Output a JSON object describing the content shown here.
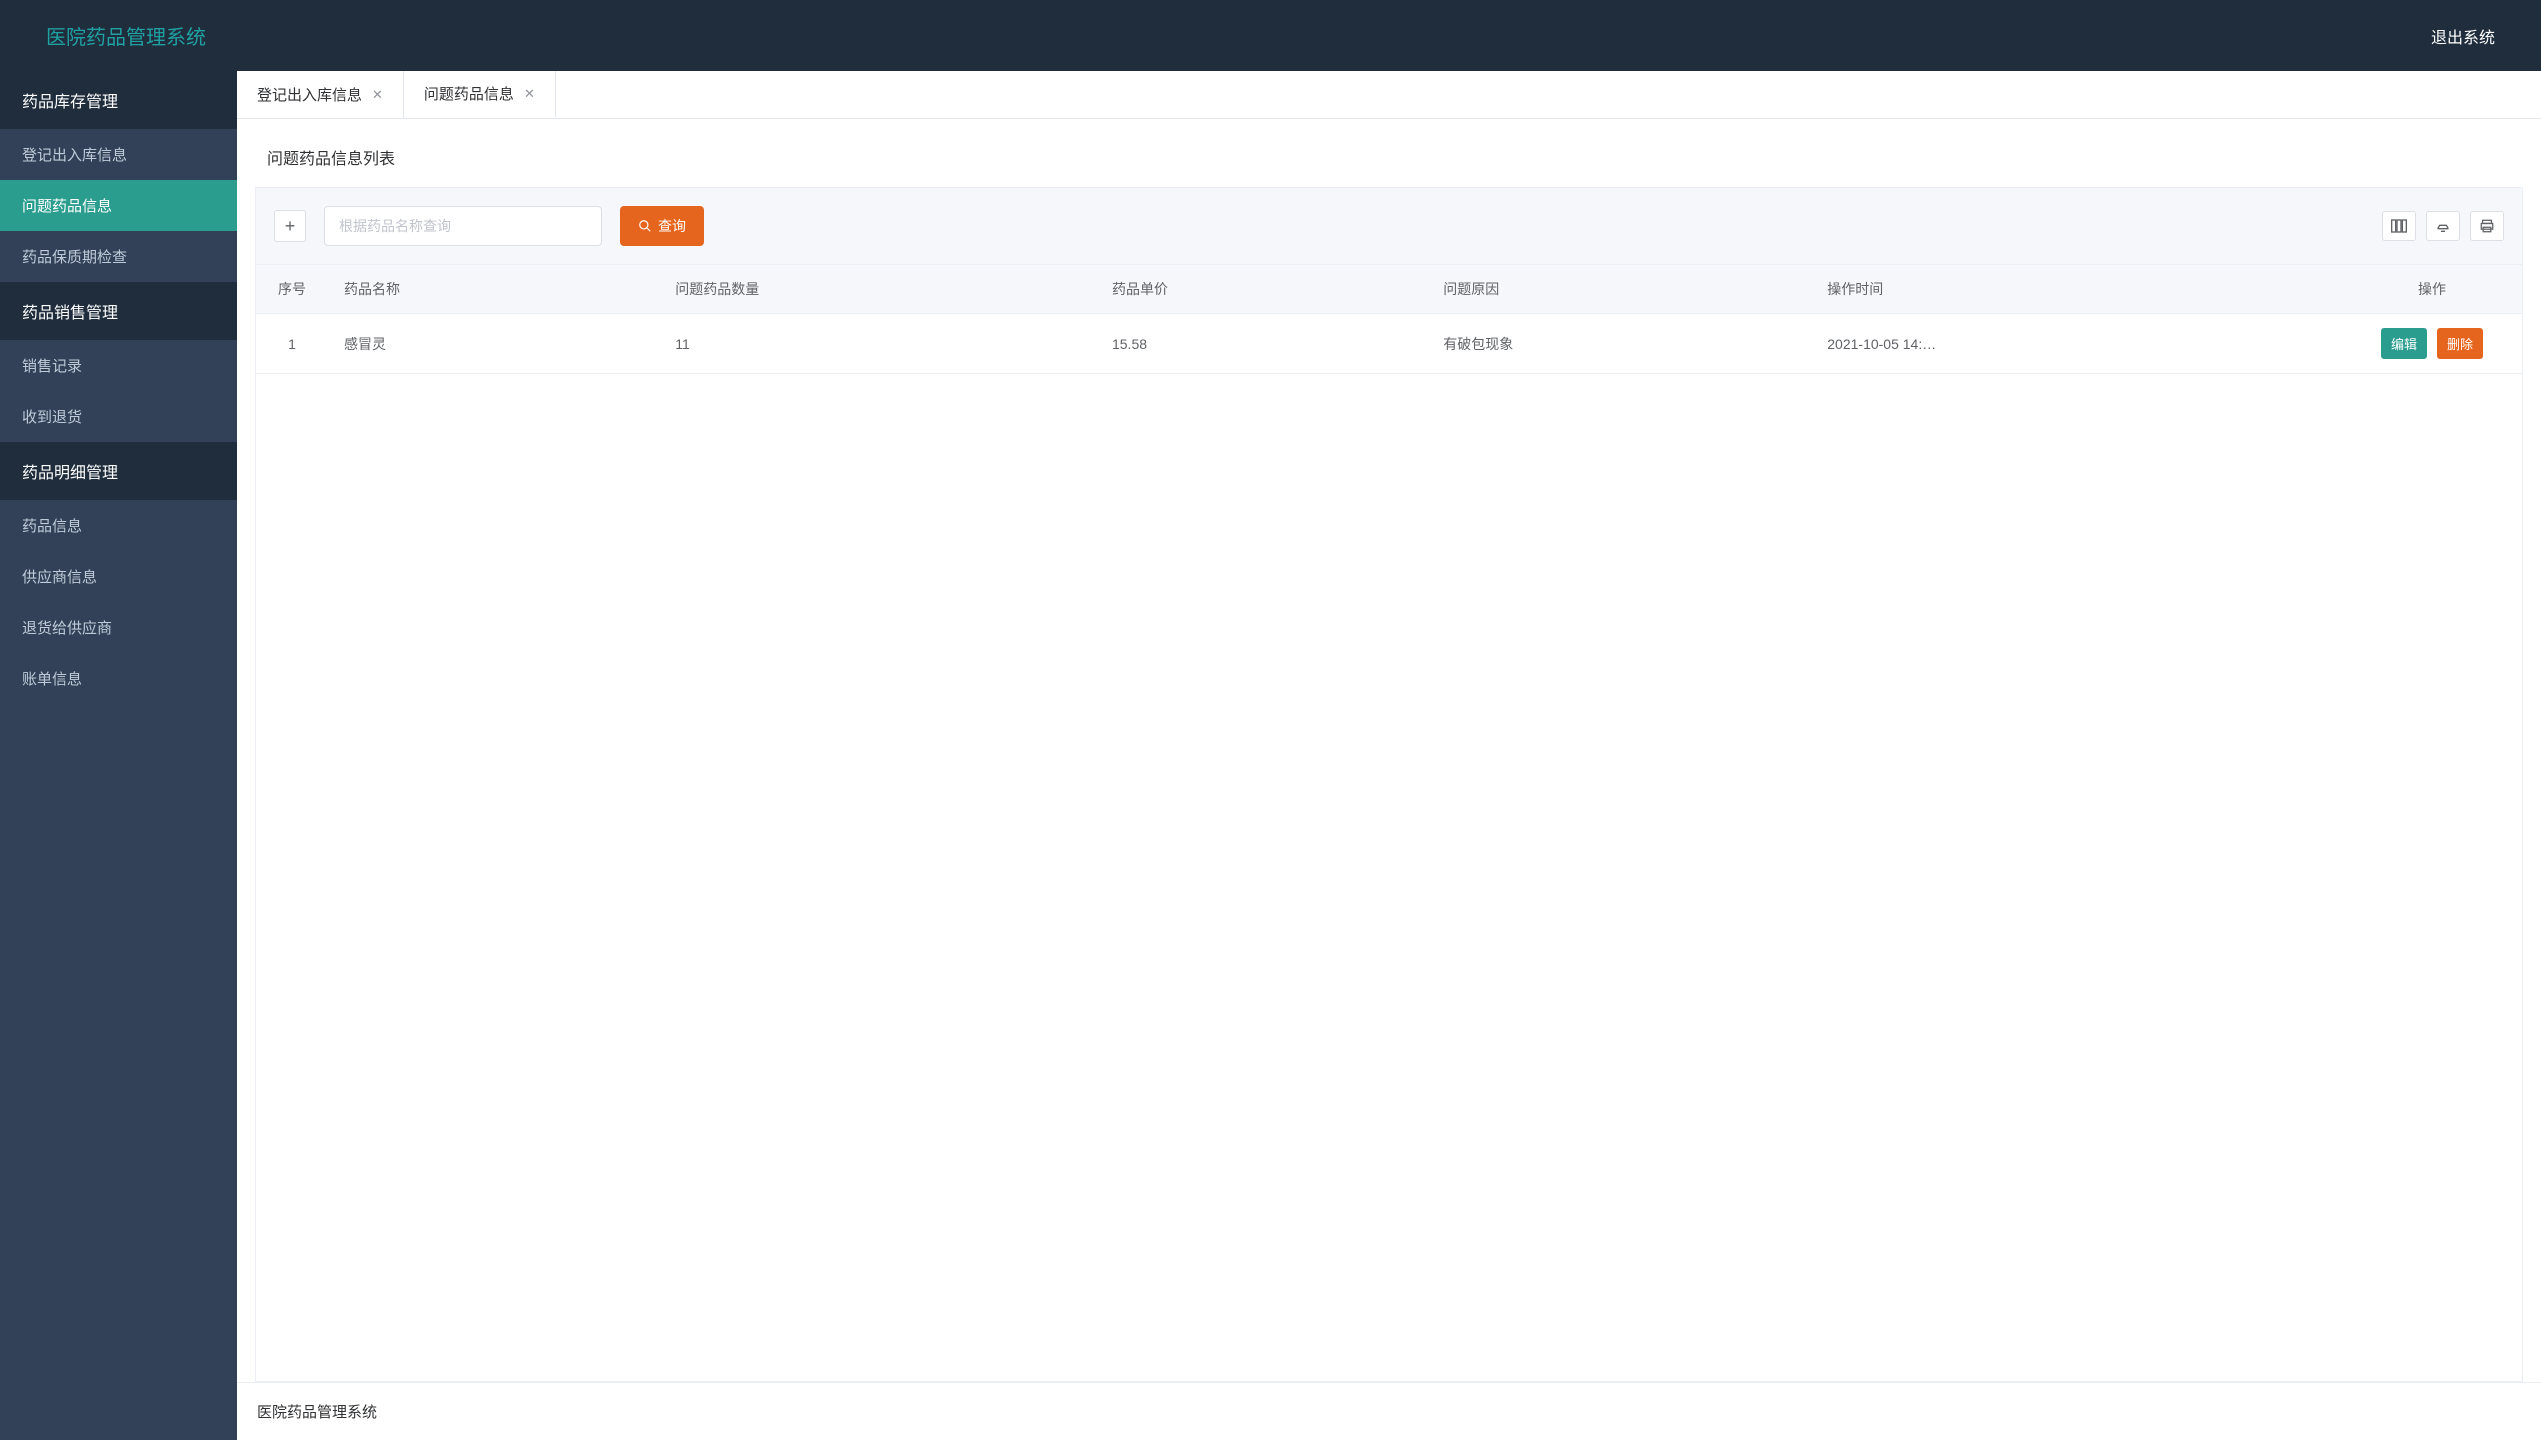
{
  "header": {
    "title": "医院药品管理系统",
    "logout": "退出系统"
  },
  "sidebar": {
    "groups": [
      {
        "label": "药品库存管理",
        "items": [
          {
            "label": "登记出入库信息",
            "active": false
          },
          {
            "label": "问题药品信息",
            "active": true
          },
          {
            "label": "药品保质期检查",
            "active": false
          }
        ]
      },
      {
        "label": "药品销售管理",
        "items": [
          {
            "label": "销售记录",
            "active": false
          },
          {
            "label": "收到退货",
            "active": false
          }
        ]
      },
      {
        "label": "药品明细管理",
        "items": [
          {
            "label": "药品信息",
            "active": false
          },
          {
            "label": "供应商信息",
            "active": false
          },
          {
            "label": "退货给供应商",
            "active": false
          },
          {
            "label": "账单信息",
            "active": false
          }
        ]
      }
    ]
  },
  "tabs": [
    {
      "label": "登记出入库信息",
      "active": false
    },
    {
      "label": "问题药品信息",
      "active": true
    }
  ],
  "content": {
    "title": "问题药品信息列表",
    "search_placeholder": "根据药品名称查询",
    "search_button": "查询",
    "table": {
      "headers": [
        "序号",
        "药品名称",
        "问题药品数量",
        "药品单价",
        "问题原因",
        "操作时间",
        "操作"
      ],
      "rows": [
        {
          "seq": "1",
          "name": "感冒灵",
          "qty": "11",
          "price": "15.58",
          "reason": "有破包现象",
          "time": "2021-10-05 14:…"
        }
      ]
    },
    "actions": {
      "edit": "编辑",
      "delete": "删除"
    }
  },
  "footer": {
    "text": "医院药品管理系统"
  }
}
